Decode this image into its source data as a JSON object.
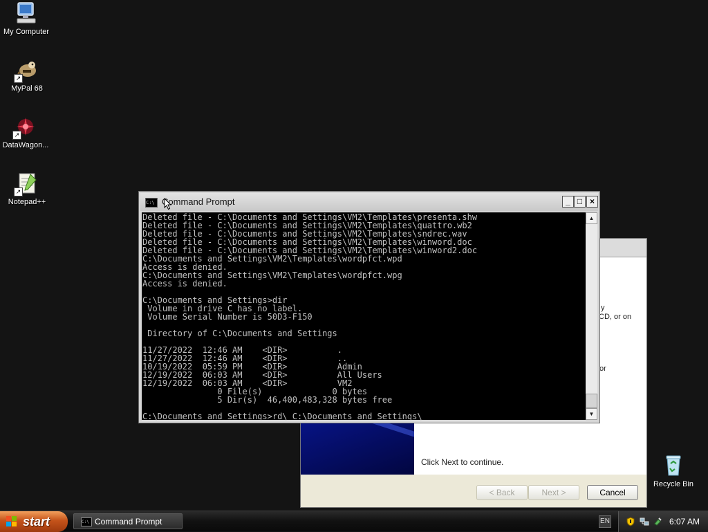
{
  "desktop": {
    "icons": [
      {
        "label": "My Computer"
      },
      {
        "label": "MyPal 68"
      },
      {
        "label": "DataWagon..."
      },
      {
        "label": "Notepad++"
      },
      {
        "label": "Recycle Bin"
      }
    ]
  },
  "wizard": {
    "fragments": [
      "y",
      "CD, or on",
      "or"
    ],
    "continue_text": "Click Next to continue.",
    "back_label": "< Back",
    "next_label": "Next >",
    "cancel_label": "Cancel"
  },
  "cmd": {
    "title": "Command Prompt",
    "icon_text": "C:\\",
    "minimize": "_",
    "maximize": "□",
    "close": "×",
    "scroll_up": "▲",
    "scroll_down": "▼",
    "lines": [
      "Deleted file - C:\\Documents and Settings\\VM2\\Templates\\presenta.shw",
      "Deleted file - C:\\Documents and Settings\\VM2\\Templates\\quattro.wb2",
      "Deleted file - C:\\Documents and Settings\\VM2\\Templates\\sndrec.wav",
      "Deleted file - C:\\Documents and Settings\\VM2\\Templates\\winword.doc",
      "Deleted file - C:\\Documents and Settings\\VM2\\Templates\\winword2.doc",
      "C:\\Documents and Settings\\VM2\\Templates\\wordpfct.wpd",
      "Access is denied.",
      "C:\\Documents and Settings\\VM2\\Templates\\wordpfct.wpg",
      "Access is denied.",
      "",
      "C:\\Documents and Settings>dir",
      " Volume in drive C has no label.",
      " Volume Serial Number is 50D3-F150",
      "",
      " Directory of C:\\Documents and Settings",
      "",
      "11/27/2022  12:46 AM    <DIR>          .",
      "11/27/2022  12:46 AM    <DIR>          ..",
      "10/19/2022  05:59 PM    <DIR>          Admin",
      "12/19/2022  06:03 AM    <DIR>          All Users",
      "12/19/2022  06:03 AM    <DIR>          VM2",
      "               0 File(s)              0 bytes",
      "               5 Dir(s)  46,400,483,328 bytes free",
      "",
      "C:\\Documents and Settings>rd\\ C:\\Documents and Settings\\"
    ]
  },
  "taskbar": {
    "start_label": "start",
    "task_label": "Command Prompt",
    "task_icon_text": "C:\\",
    "lang": "EN",
    "clock": "6:07 AM"
  },
  "colors": {
    "desktop_bg": "#141414",
    "console_bg": "#000000",
    "console_fg": "#c0c0c0",
    "start_orange": "#c4531a"
  }
}
